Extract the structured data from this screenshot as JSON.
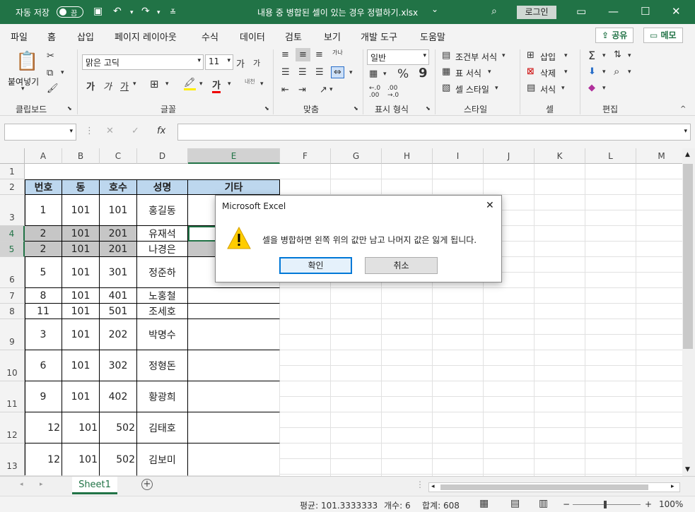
{
  "titlebar": {
    "autosave_label": "자동 저장",
    "autosave_state": "끔",
    "doc_title": "내용 중 병합된 셀이 있는 경우 정렬하기.xlsx",
    "doc_title_caret": "⌄",
    "login_label": "로그인"
  },
  "menu": {
    "items": [
      "파일",
      "홈",
      "삽입",
      "페이지 레이아웃",
      "수식",
      "데이터",
      "검토",
      "보기",
      "개발 도구",
      "도움말"
    ],
    "active": "홈",
    "share_label": "공유",
    "memo_label": "메모"
  },
  "ribbon": {
    "clipboard": {
      "paste_label": "붙여넣기",
      "group_label": "클립보드"
    },
    "font": {
      "font_name": "맑은 고딕",
      "font_size": "11",
      "grow": "가",
      "shrink": "가",
      "bold": "가",
      "italic": "가",
      "underline": "가",
      "group_label": "글꼴",
      "font_color_glyph": "가",
      "phonetic": "내천"
    },
    "alignment": {
      "group_label": "맞춤",
      "wrap": "가나"
    },
    "number": {
      "format": "일반",
      "percent": "%",
      "comma": "9",
      "group_label": "표시 형식"
    },
    "styles": {
      "conditional": "조건부 서식",
      "table": "표 서식",
      "cell_style": "셀 스타일",
      "group_label": "스타일"
    },
    "cells": {
      "insert": "삽입",
      "delete": "삭제",
      "format": "서식",
      "group_label": "셀"
    },
    "editing": {
      "group_label": "편집"
    }
  },
  "formula_bar": {
    "name_box": "",
    "formula": "",
    "fx": "fx"
  },
  "grid": {
    "columns": [
      "A",
      "B",
      "C",
      "D",
      "E",
      "F",
      "G",
      "H",
      "I",
      "J",
      "K",
      "L",
      "M"
    ],
    "selected_column": "E",
    "rows": [
      "1",
      "2",
      "3",
      "4",
      "5",
      "6",
      "7",
      "8",
      "9",
      "10",
      "11",
      "12",
      "13"
    ],
    "selected_rows": [
      "4",
      "5"
    ],
    "headers": [
      "번호",
      "동",
      "호수",
      "성명",
      "기타"
    ],
    "data": [
      {
        "row": "3",
        "no": "1",
        "dong": "101",
        "ho": "101",
        "name": "홍길동"
      },
      {
        "row": "4",
        "no": "2",
        "dong": "101",
        "ho": "201",
        "name": "유재석"
      },
      {
        "row": "5",
        "no": "2",
        "dong": "101",
        "ho": "201",
        "name": "나경은"
      },
      {
        "row": "6",
        "no": "5",
        "dong": "101",
        "ho": "301",
        "name": "정준하"
      },
      {
        "row": "7",
        "no": "8",
        "dong": "101",
        "ho": "401",
        "name": "노홍철"
      },
      {
        "row": "8",
        "no": "11",
        "dong": "101",
        "ho": "501",
        "name": "조세호"
      },
      {
        "row": "9",
        "no": "3",
        "dong": "101",
        "ho": "202",
        "name": "박명수"
      },
      {
        "row": "10",
        "no": "6",
        "dong": "101",
        "ho": "302",
        "name": "정형돈"
      },
      {
        "row": "11",
        "no": "9",
        "dong": "101",
        "ho": "402",
        "name": "황광희"
      },
      {
        "row": "12",
        "no": "12",
        "dong": "101",
        "ho": "502",
        "name": "김태호"
      },
      {
        "row": "13",
        "no": "12",
        "dong": "101",
        "ho": "502",
        "name": "김보미"
      }
    ]
  },
  "sheet_tabs": {
    "active": "Sheet1",
    "add": "+"
  },
  "status": {
    "average": "평균: 101.3333333",
    "count": "개수: 6",
    "sum": "합계: 608",
    "zoom": "100%"
  },
  "dialog": {
    "title": "Microsoft Excel",
    "message": "셀을 병합하면 왼쪽 위의 값만 남고 나머지 값은 잃게 됩니다.",
    "ok": "확인",
    "cancel": "취소",
    "close_glyph": "✕"
  }
}
